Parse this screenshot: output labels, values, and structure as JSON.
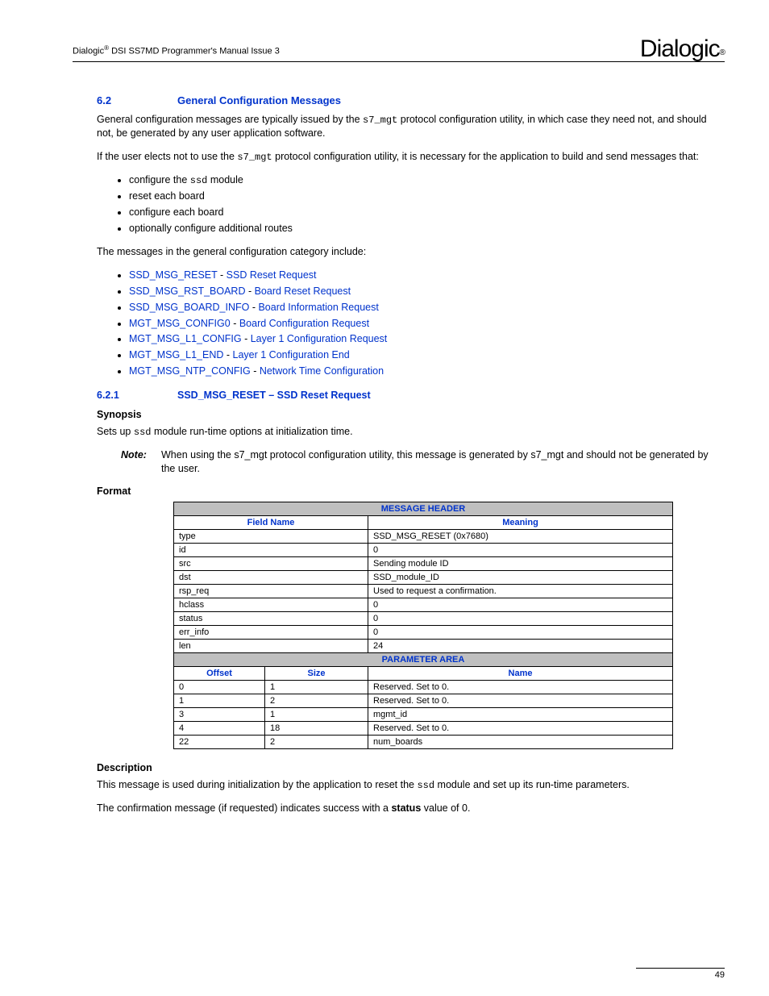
{
  "header": {
    "left_pre": "Dialogic",
    "left_reg": "®",
    "left_post": " DSI SS7MD Programmer's Manual Issue 3",
    "logo_text": "Dialogic",
    "logo_reg": "®"
  },
  "section62": {
    "num": "6.2",
    "title": "General Configuration Messages",
    "p1a": "General configuration messages are typically issued by the ",
    "p1_mono": "s7_mgt",
    "p1b": " protocol configuration utility, in which case they need not, and should not, be generated by any user application software.",
    "p2a": "If the user elects not to use the ",
    "p2_mono": "s7_mgt",
    "p2b": " protocol configuration utility, it is necessary for the application to build and send messages that:",
    "bullets1": [
      {
        "pre": "configure the ",
        "mono": "ssd",
        "post": " module"
      },
      {
        "pre": "reset each board",
        "mono": "",
        "post": ""
      },
      {
        "pre": "configure each board",
        "mono": "",
        "post": ""
      },
      {
        "pre": "optionally configure additional routes",
        "mono": "",
        "post": ""
      }
    ],
    "p3": "The messages in the general configuration category include:",
    "bullets2": [
      {
        "a": "SSD_MSG_RESET",
        "sep": " - ",
        "b": "SSD Reset Request"
      },
      {
        "a": "SSD_MSG_RST_BOARD",
        "sep": " - ",
        "b": "Board Reset Request"
      },
      {
        "a": "SSD_MSG_BOARD_INFO",
        "sep": " - ",
        "b": "Board Information Request"
      },
      {
        "a": "MGT_MSG_CONFIG0",
        "sep": " - ",
        "b": "Board Configuration Request"
      },
      {
        "a": "MGT_MSG_L1_CONFIG",
        "sep": " - ",
        "b": "Layer 1 Configuration Request"
      },
      {
        "a": "MGT_MSG_L1_END",
        "sep": " - ",
        "b": "Layer 1 Configuration End"
      },
      {
        "a": "MGT_MSG_NTP_CONFIG",
        "sep": " - ",
        "b": "Network Time Configuration"
      }
    ]
  },
  "section621": {
    "num": "6.2.1",
    "title": "SSD_MSG_RESET – SSD Reset Request",
    "synopsis_label": "Synopsis",
    "synopsis_a": "Sets up ",
    "synopsis_mono": "ssd",
    "synopsis_b": " module run-time options at initialization time.",
    "note_label": "Note:",
    "note_text": "When using the s7_mgt protocol configuration utility, this message is generated by s7_mgt and should not be generated by the user.",
    "format_label": "Format",
    "table": {
      "msg_header": "MESSAGE HEADER",
      "col_field": "Field Name",
      "col_meaning": "Meaning",
      "rows1": [
        {
          "f": "type",
          "m": "SSD_MSG_RESET (0x7680)"
        },
        {
          "f": "id",
          "m": "0"
        },
        {
          "f": "src",
          "m": "Sending module ID"
        },
        {
          "f": "dst",
          "m": "SSD_module_ID"
        },
        {
          "f": "rsp_req",
          "m": "Used to request a confirmation."
        },
        {
          "f": "hclass",
          "m": "0"
        },
        {
          "f": "status",
          "m": "0"
        },
        {
          "f": "err_info",
          "m": "0"
        },
        {
          "f": "len",
          "m": "24"
        }
      ],
      "param_area": "PARAMETER AREA",
      "col_offset": "Offset",
      "col_size": "Size",
      "col_name": "Name",
      "rows2": [
        {
          "o": "0",
          "s": "1",
          "n": "Reserved. Set to 0."
        },
        {
          "o": "1",
          "s": "2",
          "n": "Reserved. Set to 0."
        },
        {
          "o": "3",
          "s": "1",
          "n": "mgmt_id"
        },
        {
          "o": "4",
          "s": "18",
          "n": "Reserved. Set to 0."
        },
        {
          "o": "22",
          "s": "2",
          "n": "num_boards"
        }
      ]
    },
    "desc_label": "Description",
    "desc_p1a": "This message is used during initialization by the application to reset the ",
    "desc_p1_mono": "ssd",
    "desc_p1b": " module and set up its run-time parameters.",
    "desc_p2a": "The confirmation message (if requested) indicates success with a ",
    "desc_p2_bold": "status",
    "desc_p2b": " value of 0."
  },
  "page_number": "49"
}
